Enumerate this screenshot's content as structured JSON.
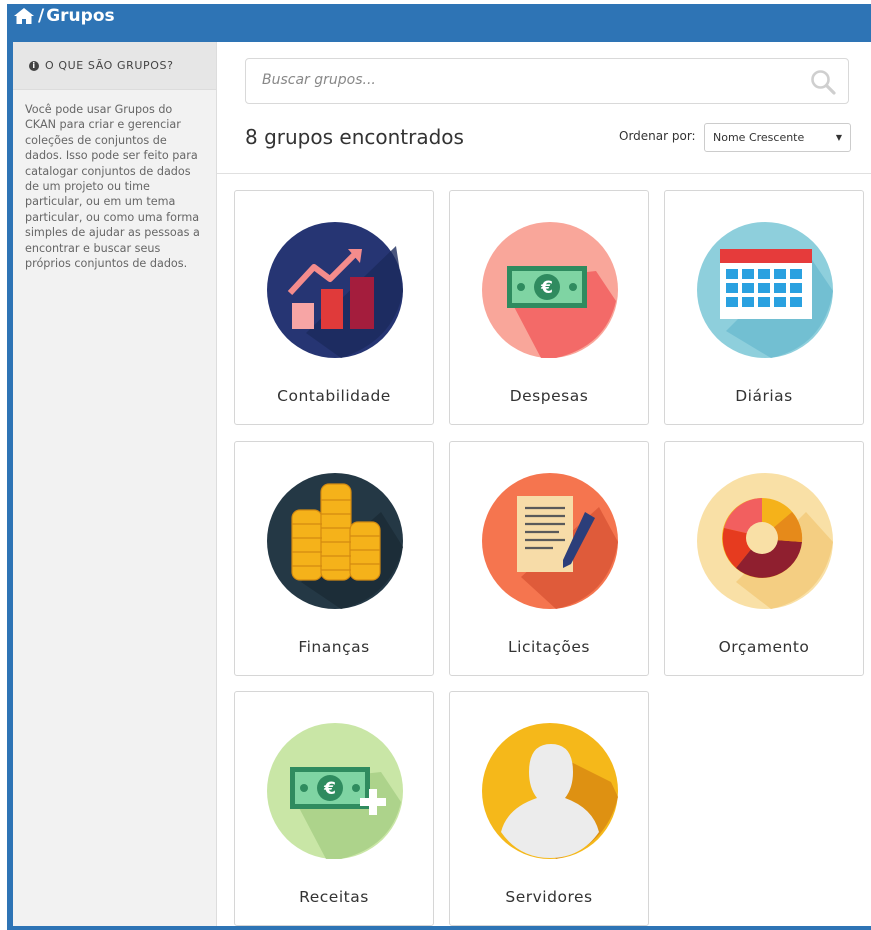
{
  "header": {
    "home_icon": "home-icon",
    "separator": "/",
    "title": "Grupos",
    "color": "#2e74b5"
  },
  "sidebar": {
    "heading": "O QUE SÃO GRUPOS?",
    "info_icon": "info-circle-icon",
    "description": "Você pode usar Grupos do CKAN para criar e gerenciar coleções de conjuntos de dados. Isso pode ser feito para catalogar conjuntos de dados de um projeto ou time particular, ou em um tema particular, ou como uma forma simples de ajudar as pessoas a encontrar e buscar seus próprios conjuntos de dados."
  },
  "search": {
    "placeholder": "Buscar grupos...",
    "value": "",
    "icon": "search-icon"
  },
  "results": {
    "count_label": "8 grupos encontrados",
    "sort_label": "Ordenar por:",
    "sort_selected": "Nome Crescente"
  },
  "groups": [
    {
      "label": "Contabilidade",
      "icon": "chart-growth-icon"
    },
    {
      "label": "Despesas",
      "icon": "euro-banknote-icon"
    },
    {
      "label": "Diárias",
      "icon": "calendar-icon"
    },
    {
      "label": "Finanças",
      "icon": "coin-stacks-icon"
    },
    {
      "label": "Licitações",
      "icon": "document-pen-icon"
    },
    {
      "label": "Orçamento",
      "icon": "donut-chart-icon"
    },
    {
      "label": "Receitas",
      "icon": "euro-banknote-plus-icon"
    },
    {
      "label": "Servidores",
      "icon": "person-silhouette-icon"
    }
  ]
}
